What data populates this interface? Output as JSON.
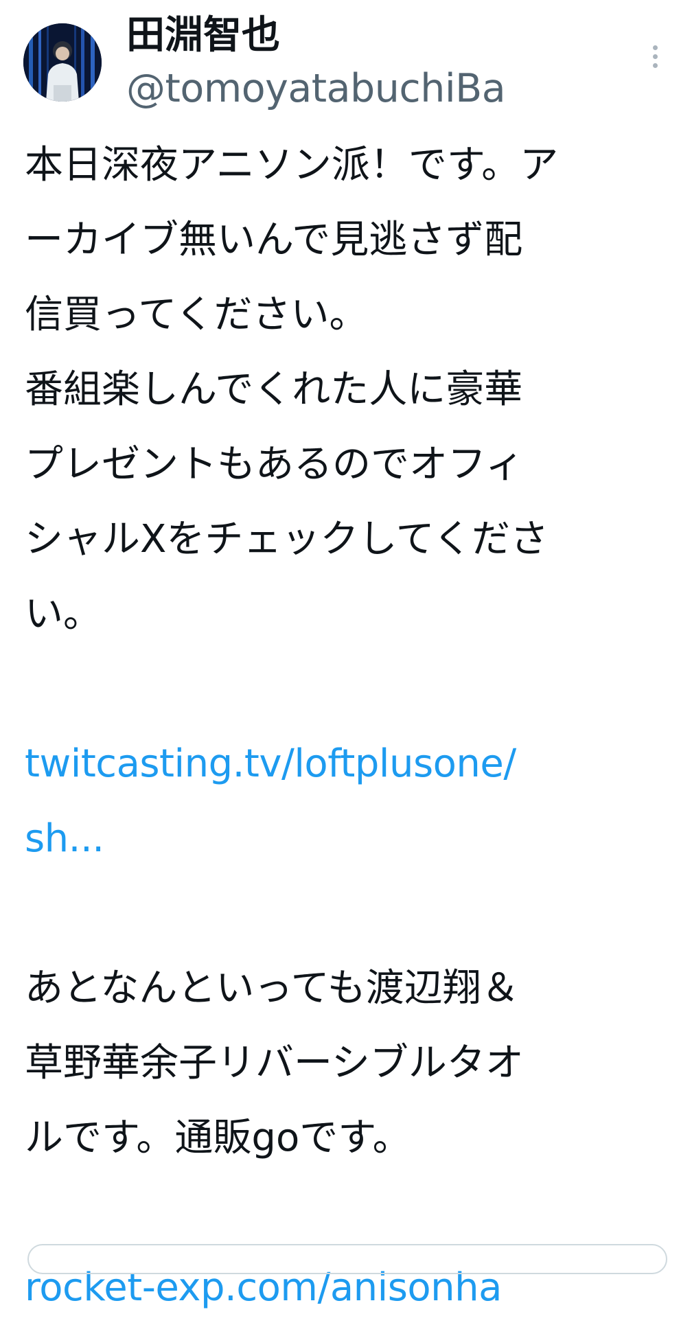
{
  "author": {
    "display_name": "田淵智也",
    "handle": "@tomoyatabuchiBa"
  },
  "tweet": {
    "lines": [
      "本日深夜アニソン派！です。ア",
      "ーカイブ無いんで見逃さず配",
      "信買ってください。",
      "番組楽しんでくれた人に豪華",
      "プレゼントもあるのでオフィ",
      "シャルXをチェックしてくださ",
      "い。"
    ],
    "link1_line1": "twitcasting.tv/loftplusone/",
    "link1_line2": "sh...",
    "lines2": [
      "あとなんといっても渡辺翔＆",
      "草野華余子リバーシブルタオ",
      "ルです。通販goです。"
    ],
    "link2": "rocket-exp.com/anisonha"
  },
  "icons": {
    "more": "more-vertical-icon",
    "avatar": "user-avatar"
  },
  "colors": {
    "text": "#0f1419",
    "secondary": "#536471",
    "link": "#1d9bf0"
  }
}
